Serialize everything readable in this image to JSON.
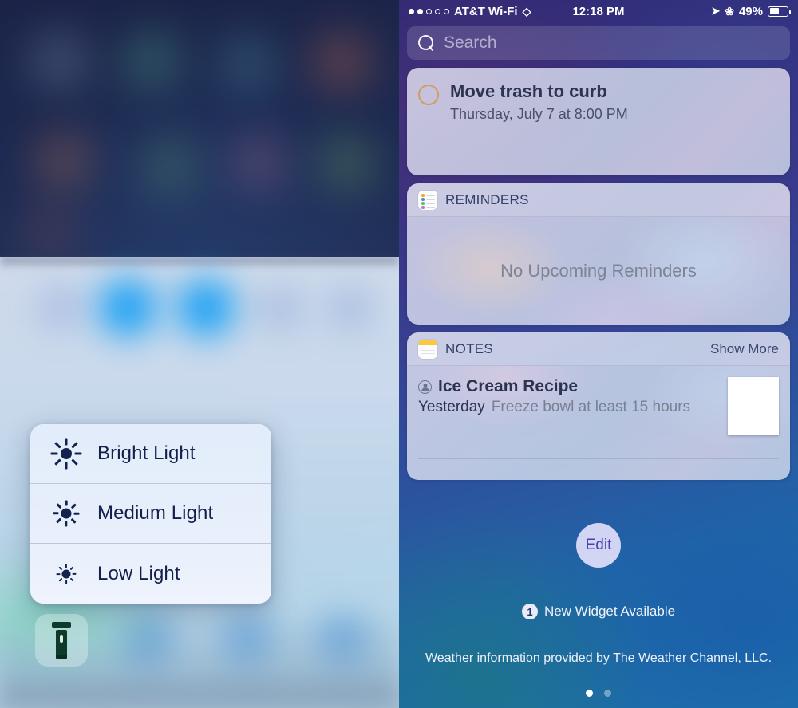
{
  "left_panel": {
    "name": "control-center-flashlight-3d-touch",
    "flashlight_menu": {
      "items": [
        {
          "label": "Bright Light",
          "icon": "brightness-high-icon",
          "level": "high"
        },
        {
          "label": "Medium Light",
          "icon": "brightness-medium-icon",
          "level": "medium"
        },
        {
          "label": "Low Light",
          "icon": "brightness-low-icon",
          "level": "low"
        }
      ]
    },
    "flashlight_icon": "flashlight-icon"
  },
  "right_panel": {
    "status_bar": {
      "signal_dots_filled": 2,
      "signal_dots_total": 5,
      "carrier": "AT&T Wi-Fi",
      "wifi_icon": "wifi-icon",
      "time": "12:18 PM",
      "location_icon": "location-arrow-icon",
      "bluetooth_icon": "bluetooth-icon",
      "battery_percent": "49%"
    },
    "search": {
      "icon": "search-icon",
      "placeholder": "Search"
    },
    "reminder_card": {
      "checkbox_icon": "reminder-circle-icon",
      "title": "Move trash to curb",
      "subtitle": "Thursday, July 7 at 8:00 PM",
      "circle_color": "#d59a62"
    },
    "reminders_widget": {
      "icon": "reminders-app-icon",
      "title": "REMINDERS",
      "empty_text": "No Upcoming Reminders"
    },
    "notes_widget": {
      "icon": "notes-app-icon",
      "title": "NOTES",
      "show_more": "Show More",
      "note": {
        "account_icon": "account-circle-icon",
        "title": "Ice Cream Recipe",
        "date": "Yesterday",
        "snippet": "Freeze bowl at least 15 hours",
        "thumbnail": "document-thumbnail"
      }
    },
    "edit_button": {
      "label": "Edit"
    },
    "new_widget_notice": {
      "count": "1",
      "text": "New Widget Available"
    },
    "attribution": {
      "link": "Weather",
      "rest": " information provided by The Weather Channel, LLC."
    },
    "page_dots": {
      "total": 2,
      "active_index": 0
    }
  }
}
